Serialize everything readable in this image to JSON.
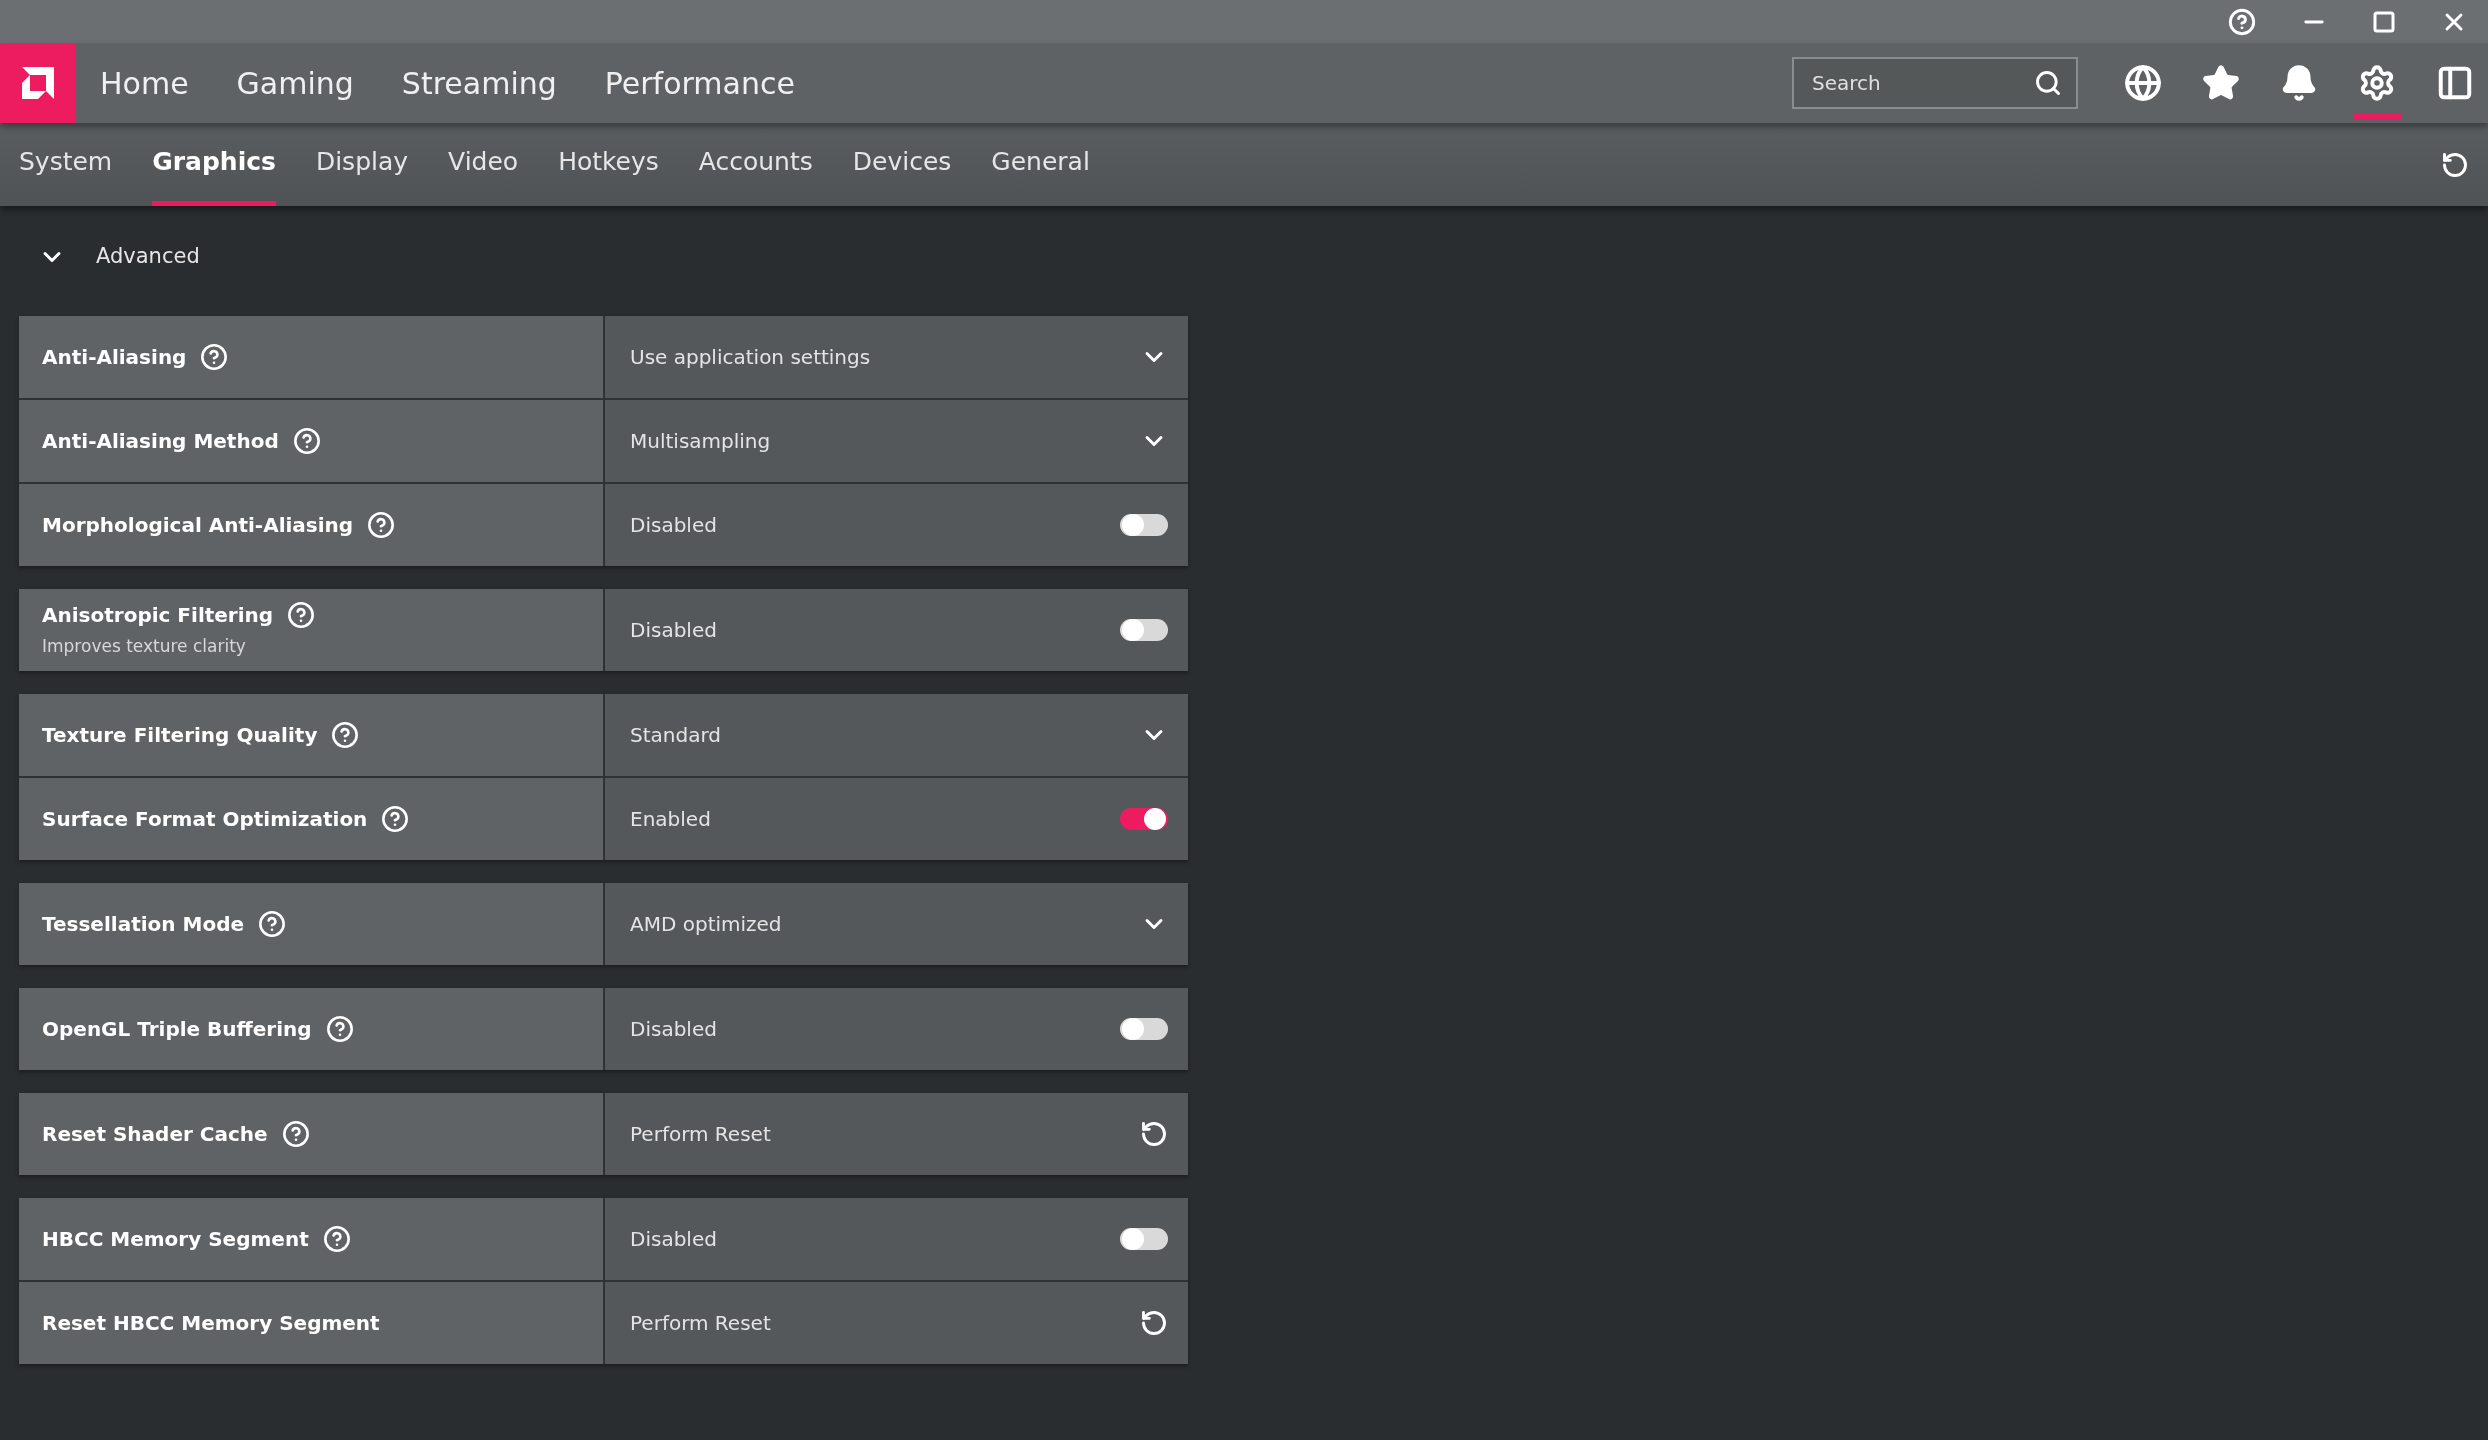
{
  "top_nav": {
    "items": [
      "Home",
      "Gaming",
      "Streaming",
      "Performance"
    ],
    "search": {
      "placeholder": "Search"
    },
    "toolbar_icons": [
      {
        "kind": "globe",
        "selected": false
      },
      {
        "kind": "star",
        "selected": false
      },
      {
        "kind": "bell",
        "selected": false
      },
      {
        "kind": "gear",
        "selected": true
      },
      {
        "kind": "sidebar",
        "selected": false
      }
    ]
  },
  "tabs": [
    {
      "label": "System",
      "selected": false
    },
    {
      "label": "Graphics",
      "selected": true
    },
    {
      "label": "Display",
      "selected": false
    },
    {
      "label": "Video",
      "selected": false
    },
    {
      "label": "Hotkeys",
      "selected": false
    },
    {
      "label": "Accounts",
      "selected": false
    },
    {
      "label": "Devices",
      "selected": false
    },
    {
      "label": "General",
      "selected": false
    }
  ],
  "section": {
    "label": "Advanced",
    "expanded": true
  },
  "groups": [
    {
      "rows": [
        {
          "label": "Anti-Aliasing",
          "help": true,
          "kind": "dropdown",
          "value": "Use application settings"
        },
        {
          "label": "Anti-Aliasing Method",
          "help": true,
          "kind": "dropdown",
          "value": "Multisampling"
        },
        {
          "label": "Morphological Anti-Aliasing",
          "help": true,
          "kind": "toggle",
          "value": "Disabled",
          "on": false
        }
      ]
    },
    {
      "rows": [
        {
          "label": "Anisotropic Filtering",
          "help": true,
          "subtitle": "Improves texture clarity",
          "kind": "toggle",
          "value": "Disabled",
          "on": false
        }
      ]
    },
    {
      "rows": [
        {
          "label": "Texture Filtering Quality",
          "help": true,
          "kind": "dropdown",
          "value": "Standard"
        },
        {
          "label": "Surface Format Optimization",
          "help": true,
          "kind": "toggle",
          "value": "Enabled",
          "on": true
        }
      ]
    },
    {
      "rows": [
        {
          "label": "Tessellation Mode",
          "help": true,
          "kind": "dropdown",
          "value": "AMD optimized"
        }
      ]
    },
    {
      "rows": [
        {
          "label": "OpenGL Triple Buffering",
          "help": true,
          "kind": "toggle",
          "value": "Disabled",
          "on": false
        }
      ]
    },
    {
      "rows": [
        {
          "label": "Reset Shader Cache",
          "help": true,
          "kind": "reset",
          "value": "Perform Reset"
        }
      ]
    },
    {
      "rows": [
        {
          "label": "HBCC Memory Segment",
          "help": true,
          "kind": "toggle",
          "value": "Disabled",
          "on": false
        },
        {
          "label": "Reset HBCC Memory Segment",
          "help": false,
          "kind": "reset",
          "value": "Perform Reset"
        }
      ]
    }
  ]
}
